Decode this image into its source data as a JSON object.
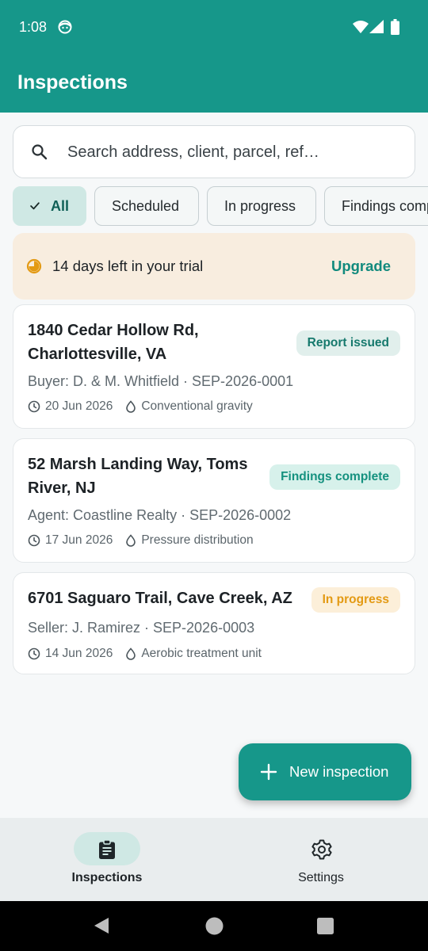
{
  "status_bar": {
    "time": "1:08"
  },
  "app_bar": {
    "title": "Inspections"
  },
  "search": {
    "placeholder": "Search address, client, parcel, ref…"
  },
  "filters": [
    {
      "label": "All",
      "selected": true
    },
    {
      "label": "Scheduled",
      "selected": false
    },
    {
      "label": "In progress",
      "selected": false
    },
    {
      "label": "Findings complete",
      "selected": false
    }
  ],
  "trial_banner": {
    "message": "14 days left in your trial",
    "action": "Upgrade"
  },
  "inspections": [
    {
      "address": "1840 Cedar Hollow Rd, Charlottesville, VA",
      "status": "Report issued",
      "subtitle": "Buyer: D. & M. Whitfield · SEP-2026-0001",
      "date": "20 Jun 2026",
      "system": "Conventional gravity"
    },
    {
      "address": "52 Marsh Landing Way, Toms River, NJ",
      "status": "Findings complete",
      "subtitle": "Agent: Coastline Realty · SEP-2026-0002",
      "date": "17 Jun 2026",
      "system": "Pressure distribution"
    },
    {
      "address": "6701 Saguaro Trail, Cave Creek, AZ",
      "status": "In progress",
      "subtitle": "Seller: J. Ramirez · SEP-2026-0003",
      "date": "14 Jun 2026",
      "system": "Aerobic treatment unit"
    }
  ],
  "fab": {
    "label": "New inspection"
  },
  "bottom_nav": [
    {
      "label": "Inspections",
      "icon": "clipboard-icon",
      "active": true
    },
    {
      "label": "Settings",
      "icon": "gear-icon",
      "active": false
    }
  ],
  "colors": {
    "primary": "#16978a",
    "trial_bg": "#f8eddf",
    "accent_orange": "#e39a14"
  }
}
